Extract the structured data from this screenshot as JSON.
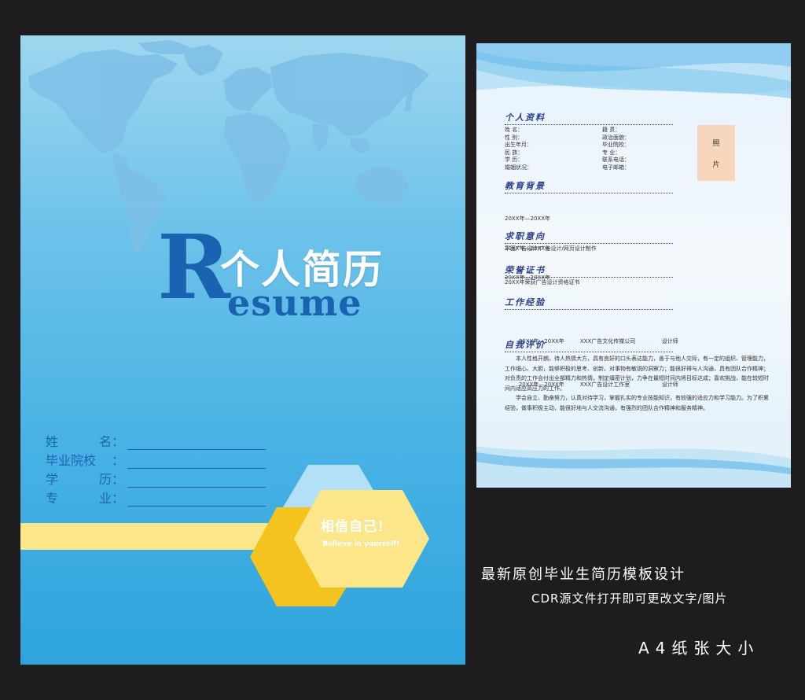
{
  "cover": {
    "title_cn": "个人简历",
    "title_r": "R",
    "title_esume": "esume",
    "fields": [
      {
        "label": "姓名",
        "colon": "："
      },
      {
        "label": "毕业院校",
        "colon": "："
      },
      {
        "label": "学历",
        "colon": "："
      },
      {
        "label": "专业",
        "colon": "："
      }
    ],
    "slogan_cn": "相信自己！",
    "slogan_en": "Believe in yourself!"
  },
  "inner": {
    "personal": {
      "title": "个人资料",
      "left": [
        "姓 名：",
        "性 别：",
        "出生年月：",
        "民 族：",
        "学 历：",
        "婚姻状况："
      ],
      "right": [
        "籍 贯：",
        "政治面貌：",
        "毕业院校：",
        "专 业：",
        "联系电话：",
        "电子邮箱："
      ]
    },
    "photo": {
      "line1": "照",
      "line2": "片"
    },
    "education": {
      "title": "教育背景",
      "lines": [
        "20XX年—20XX年",
        "20XX年—20XX年",
        "20XX年—20XX年"
      ]
    },
    "job": {
      "title": "求职意向",
      "lines": [
        "平面广告设计/广告设计/网页设计制作"
      ]
    },
    "honors": {
      "title": "荣誉证书",
      "lines": [
        "20XX年荣获广告设计资格证书"
      ]
    },
    "work": {
      "title": "工作经验",
      "rows": [
        {
          "period": "20XX年—20XX年",
          "company": "XXX广告文化传媒公司",
          "role": "设计师"
        },
        {
          "period": "20XX年—20XX年",
          "company": "XXX广告设计工作室",
          "role": "设计师"
        }
      ]
    },
    "self": {
      "title": "自我评价",
      "paragraphs": [
        "本人性格开朗，待人热情大方，具有良好的口头表达能力，善于与他人交际，有一定的组织、管理能力，工作细心、大胆，能够积极的思考、创新。对事物有敏锐的洞察力；能很好得与人沟通，具有团队合作精神；对负责的工作会付出全部精力和热情，制定缜密计划，力争在最短时间内将目标达成；喜欢挑战，能在较短时间内适应高压力的工作。",
        "学会自立、勤奋努力，认真对待学习，掌握扎实的专业技能知识，有较强的适应力和学习能力。为了积累经验，做事积极主动，能很好地与人交流沟通，有强烈的团队合作精神和服务精神。"
      ]
    }
  },
  "captions": {
    "line1": "最新原创毕业生简历模板设计",
    "line2": "CDR源文件打开即可更改文字/图片",
    "line3": "A4纸张大小"
  },
  "colors": {
    "background": "#1e1c1e",
    "cover_blue": "#48b2e4",
    "title_blue": "#1a63b0",
    "yellow": "#f5c31e",
    "light_yellow": "#fbe68a",
    "section_title": "#2b3f8e"
  }
}
